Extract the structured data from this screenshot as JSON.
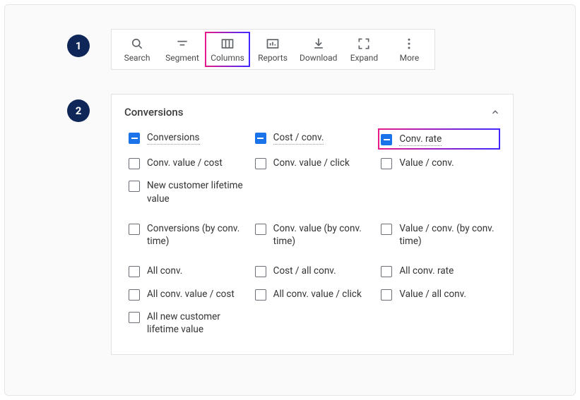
{
  "steps": {
    "one": "1",
    "two": "2"
  },
  "toolbar": [
    {
      "key": "search",
      "label": "Search",
      "icon": "search-icon",
      "hl": false
    },
    {
      "key": "segment",
      "label": "Segment",
      "icon": "segment-icon",
      "hl": false
    },
    {
      "key": "columns",
      "label": "Columns",
      "icon": "columns-icon",
      "hl": true
    },
    {
      "key": "reports",
      "label": "Reports",
      "icon": "reports-icon",
      "hl": false
    },
    {
      "key": "download",
      "label": "Download",
      "icon": "download-icon",
      "hl": false
    },
    {
      "key": "expand",
      "label": "Expand",
      "icon": "expand-icon",
      "hl": false
    },
    {
      "key": "more",
      "label": "More",
      "icon": "more-icon",
      "hl": false
    }
  ],
  "panel": {
    "title": "Conversions",
    "items": [
      {
        "label": "Conversions",
        "state": "ind",
        "dotted": true,
        "hl": false
      },
      {
        "label": "Cost / conv.",
        "state": "ind",
        "dotted": true,
        "hl": false
      },
      {
        "label": "Conv. rate",
        "state": "ind",
        "dotted": true,
        "hl": true
      },
      {
        "label": "Conv. value / cost",
        "state": "off",
        "dotted": false,
        "hl": false
      },
      {
        "label": "Conv. value / click",
        "state": "off",
        "dotted": false,
        "hl": false
      },
      {
        "label": "Value / conv.",
        "state": "off",
        "dotted": false,
        "hl": false
      },
      {
        "label": "New customer lifetime value",
        "state": "off",
        "dotted": false,
        "hl": false
      },
      {
        "label": "",
        "spacer": true
      },
      {
        "label": "",
        "spacer": true
      },
      {
        "label": "",
        "gap": true
      },
      {
        "label": "Conversions (by conv. time)",
        "state": "off",
        "dotted": false,
        "hl": false
      },
      {
        "label": "Conv. value (by conv. time)",
        "state": "off",
        "dotted": false,
        "hl": false
      },
      {
        "label": "Value / conv. (by conv. time)",
        "state": "off",
        "dotted": false,
        "hl": false
      },
      {
        "label": "",
        "gap": true
      },
      {
        "label": "All conv.",
        "state": "off",
        "dotted": false,
        "hl": false
      },
      {
        "label": "Cost / all conv.",
        "state": "off",
        "dotted": false,
        "hl": false
      },
      {
        "label": "All conv. rate",
        "state": "off",
        "dotted": false,
        "hl": false
      },
      {
        "label": "All conv. value / cost",
        "state": "off",
        "dotted": false,
        "hl": false
      },
      {
        "label": "All conv. value / click",
        "state": "off",
        "dotted": false,
        "hl": false
      },
      {
        "label": "Value / all conv.",
        "state": "off",
        "dotted": false,
        "hl": false
      },
      {
        "label": "All new customer lifetime value",
        "state": "off",
        "dotted": false,
        "hl": false
      }
    ]
  }
}
